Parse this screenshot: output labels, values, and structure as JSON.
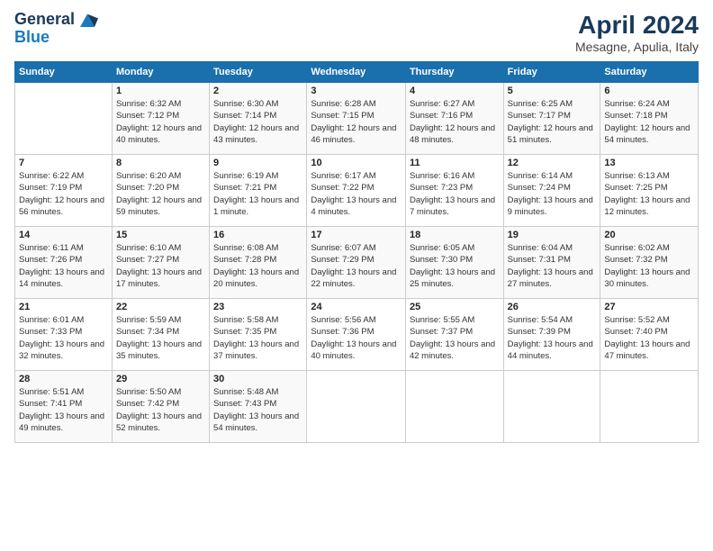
{
  "header": {
    "logo_line1": "General",
    "logo_line2": "Blue",
    "month": "April 2024",
    "location": "Mesagne, Apulia, Italy"
  },
  "weekdays": [
    "Sunday",
    "Monday",
    "Tuesday",
    "Wednesday",
    "Thursday",
    "Friday",
    "Saturday"
  ],
  "weeks": [
    [
      {
        "day": "",
        "sunrise": "",
        "sunset": "",
        "daylight": ""
      },
      {
        "day": "1",
        "sunrise": "Sunrise: 6:32 AM",
        "sunset": "Sunset: 7:12 PM",
        "daylight": "Daylight: 12 hours and 40 minutes."
      },
      {
        "day": "2",
        "sunrise": "Sunrise: 6:30 AM",
        "sunset": "Sunset: 7:14 PM",
        "daylight": "Daylight: 12 hours and 43 minutes."
      },
      {
        "day": "3",
        "sunrise": "Sunrise: 6:28 AM",
        "sunset": "Sunset: 7:15 PM",
        "daylight": "Daylight: 12 hours and 46 minutes."
      },
      {
        "day": "4",
        "sunrise": "Sunrise: 6:27 AM",
        "sunset": "Sunset: 7:16 PM",
        "daylight": "Daylight: 12 hours and 48 minutes."
      },
      {
        "day": "5",
        "sunrise": "Sunrise: 6:25 AM",
        "sunset": "Sunset: 7:17 PM",
        "daylight": "Daylight: 12 hours and 51 minutes."
      },
      {
        "day": "6",
        "sunrise": "Sunrise: 6:24 AM",
        "sunset": "Sunset: 7:18 PM",
        "daylight": "Daylight: 12 hours and 54 minutes."
      }
    ],
    [
      {
        "day": "7",
        "sunrise": "Sunrise: 6:22 AM",
        "sunset": "Sunset: 7:19 PM",
        "daylight": "Daylight: 12 hours and 56 minutes."
      },
      {
        "day": "8",
        "sunrise": "Sunrise: 6:20 AM",
        "sunset": "Sunset: 7:20 PM",
        "daylight": "Daylight: 12 hours and 59 minutes."
      },
      {
        "day": "9",
        "sunrise": "Sunrise: 6:19 AM",
        "sunset": "Sunset: 7:21 PM",
        "daylight": "Daylight: 13 hours and 1 minute."
      },
      {
        "day": "10",
        "sunrise": "Sunrise: 6:17 AM",
        "sunset": "Sunset: 7:22 PM",
        "daylight": "Daylight: 13 hours and 4 minutes."
      },
      {
        "day": "11",
        "sunrise": "Sunrise: 6:16 AM",
        "sunset": "Sunset: 7:23 PM",
        "daylight": "Daylight: 13 hours and 7 minutes."
      },
      {
        "day": "12",
        "sunrise": "Sunrise: 6:14 AM",
        "sunset": "Sunset: 7:24 PM",
        "daylight": "Daylight: 13 hours and 9 minutes."
      },
      {
        "day": "13",
        "sunrise": "Sunrise: 6:13 AM",
        "sunset": "Sunset: 7:25 PM",
        "daylight": "Daylight: 13 hours and 12 minutes."
      }
    ],
    [
      {
        "day": "14",
        "sunrise": "Sunrise: 6:11 AM",
        "sunset": "Sunset: 7:26 PM",
        "daylight": "Daylight: 13 hours and 14 minutes."
      },
      {
        "day": "15",
        "sunrise": "Sunrise: 6:10 AM",
        "sunset": "Sunset: 7:27 PM",
        "daylight": "Daylight: 13 hours and 17 minutes."
      },
      {
        "day": "16",
        "sunrise": "Sunrise: 6:08 AM",
        "sunset": "Sunset: 7:28 PM",
        "daylight": "Daylight: 13 hours and 20 minutes."
      },
      {
        "day": "17",
        "sunrise": "Sunrise: 6:07 AM",
        "sunset": "Sunset: 7:29 PM",
        "daylight": "Daylight: 13 hours and 22 minutes."
      },
      {
        "day": "18",
        "sunrise": "Sunrise: 6:05 AM",
        "sunset": "Sunset: 7:30 PM",
        "daylight": "Daylight: 13 hours and 25 minutes."
      },
      {
        "day": "19",
        "sunrise": "Sunrise: 6:04 AM",
        "sunset": "Sunset: 7:31 PM",
        "daylight": "Daylight: 13 hours and 27 minutes."
      },
      {
        "day": "20",
        "sunrise": "Sunrise: 6:02 AM",
        "sunset": "Sunset: 7:32 PM",
        "daylight": "Daylight: 13 hours and 30 minutes."
      }
    ],
    [
      {
        "day": "21",
        "sunrise": "Sunrise: 6:01 AM",
        "sunset": "Sunset: 7:33 PM",
        "daylight": "Daylight: 13 hours and 32 minutes."
      },
      {
        "day": "22",
        "sunrise": "Sunrise: 5:59 AM",
        "sunset": "Sunset: 7:34 PM",
        "daylight": "Daylight: 13 hours and 35 minutes."
      },
      {
        "day": "23",
        "sunrise": "Sunrise: 5:58 AM",
        "sunset": "Sunset: 7:35 PM",
        "daylight": "Daylight: 13 hours and 37 minutes."
      },
      {
        "day": "24",
        "sunrise": "Sunrise: 5:56 AM",
        "sunset": "Sunset: 7:36 PM",
        "daylight": "Daylight: 13 hours and 40 minutes."
      },
      {
        "day": "25",
        "sunrise": "Sunrise: 5:55 AM",
        "sunset": "Sunset: 7:37 PM",
        "daylight": "Daylight: 13 hours and 42 minutes."
      },
      {
        "day": "26",
        "sunrise": "Sunrise: 5:54 AM",
        "sunset": "Sunset: 7:39 PM",
        "daylight": "Daylight: 13 hours and 44 minutes."
      },
      {
        "day": "27",
        "sunrise": "Sunrise: 5:52 AM",
        "sunset": "Sunset: 7:40 PM",
        "daylight": "Daylight: 13 hours and 47 minutes."
      }
    ],
    [
      {
        "day": "28",
        "sunrise": "Sunrise: 5:51 AM",
        "sunset": "Sunset: 7:41 PM",
        "daylight": "Daylight: 13 hours and 49 minutes."
      },
      {
        "day": "29",
        "sunrise": "Sunrise: 5:50 AM",
        "sunset": "Sunset: 7:42 PM",
        "daylight": "Daylight: 13 hours and 52 minutes."
      },
      {
        "day": "30",
        "sunrise": "Sunrise: 5:48 AM",
        "sunset": "Sunset: 7:43 PM",
        "daylight": "Daylight: 13 hours and 54 minutes."
      },
      {
        "day": "",
        "sunrise": "",
        "sunset": "",
        "daylight": ""
      },
      {
        "day": "",
        "sunrise": "",
        "sunset": "",
        "daylight": ""
      },
      {
        "day": "",
        "sunrise": "",
        "sunset": "",
        "daylight": ""
      },
      {
        "day": "",
        "sunrise": "",
        "sunset": "",
        "daylight": ""
      }
    ]
  ]
}
